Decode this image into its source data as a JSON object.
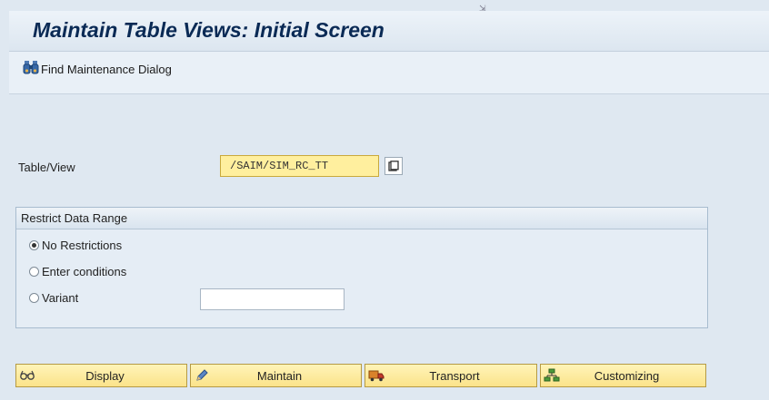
{
  "window": {
    "title": "Maintain Table Views: Initial Screen"
  },
  "toolbar": {
    "find_label": "Find Maintenance Dialog"
  },
  "form": {
    "table_view_label": "Table/View",
    "table_view_value": "/SAIM/SIM_RC_TT"
  },
  "restrict": {
    "header": "Restrict Data Range",
    "options": [
      {
        "label": "No Restrictions",
        "selected": true
      },
      {
        "label": "Enter conditions",
        "selected": false
      },
      {
        "label": "Variant",
        "selected": false
      }
    ],
    "variant_value": ""
  },
  "actions": [
    {
      "label": "Display",
      "icon": "glasses-icon"
    },
    {
      "label": "Maintain",
      "icon": "pencil-icon"
    },
    {
      "label": "Transport",
      "icon": "truck-icon"
    },
    {
      "label": "Customizing",
      "icon": "hierarchy-icon"
    }
  ],
  "colors": {
    "title_text": "#0a2a55",
    "required_field": "#ffef9e",
    "button_fill": "#fbe38a",
    "background": "#dfe8f1"
  }
}
